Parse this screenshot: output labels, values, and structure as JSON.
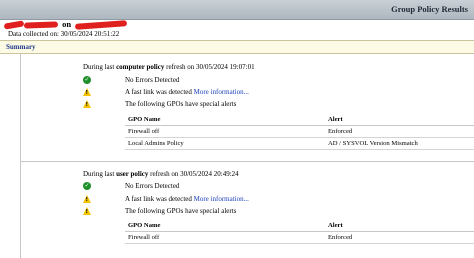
{
  "window": {
    "title": "Group Policy Results"
  },
  "header": {
    "host_separator": "on",
    "collected_label": "Data collected on: 30/05/2024 20:51:22"
  },
  "summary": {
    "label": "Summary"
  },
  "computer": {
    "heading_pre": "During last",
    "heading_bold": "computer policy",
    "heading_post": "refresh on 30/05/2024 19:07:01",
    "no_errors": "No Errors Detected",
    "fast_link_text": "A fast link was detected",
    "more_info": "More information...",
    "special_alerts": "The following GPOs have special alerts",
    "table": {
      "col1": "GPO Name",
      "col2": "Alert",
      "rows": [
        {
          "name": "Firewall off",
          "alert": "Enforced"
        },
        {
          "name": "Local Admins Policy",
          "alert": "AD / SYSVOL Version Mismatch"
        }
      ]
    }
  },
  "user": {
    "heading_pre": "During last",
    "heading_bold": "user policy",
    "heading_post": "refresh on 30/05/2024 20:49:24",
    "no_errors": "No Errors Detected",
    "fast_link_text": "A fast link was detected",
    "more_info": "More information...",
    "special_alerts": "The following GPOs have special alerts",
    "table": {
      "col1": "GPO Name",
      "col2": "Alert",
      "rows": [
        {
          "name": "Firewall off",
          "alert": "Enforced"
        }
      ]
    }
  }
}
